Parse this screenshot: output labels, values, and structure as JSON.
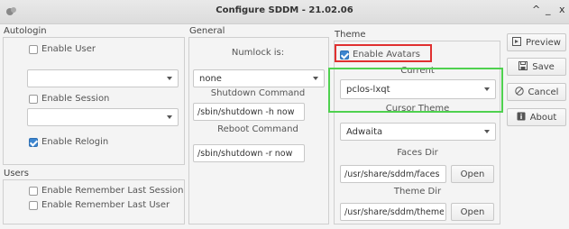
{
  "window": {
    "title": "Configure SDDM - 21.02.06",
    "controls": [
      "^",
      "_",
      "x"
    ]
  },
  "autologin": {
    "group_label": "Autologin",
    "enable_user": {
      "label": "Enable User",
      "checked": false
    },
    "user_combo": {
      "value": ""
    },
    "enable_session": {
      "label": "Enable Session",
      "checked": false
    },
    "session_combo": {
      "value": ""
    },
    "enable_relogin": {
      "label": "Enable Relogin",
      "checked": true
    }
  },
  "users": {
    "group_label": "Users",
    "remember_last_session": {
      "label": "Enable Remember Last Session",
      "checked": false
    },
    "remember_last_user": {
      "label": "Enable Remember Last User",
      "checked": false
    }
  },
  "general": {
    "group_label": "General",
    "numlock_label": "Numlock is:",
    "numlock_value": "none",
    "shutdown_label": "Shutdown Command",
    "shutdown_value": "/sbin/shutdown -h now",
    "reboot_label": "Reboot Command",
    "reboot_value": "/sbin/shutdown -r now"
  },
  "theme": {
    "group_label": "Theme",
    "enable_avatars": {
      "label": "Enable Avatars",
      "checked": true
    },
    "current_label": "Current",
    "current_value": "pclos-lxqt",
    "cursor_label": "Cursor Theme",
    "cursor_value": "Adwaita",
    "faces_label": "Faces Dir",
    "faces_value": "/usr/share/sddm/faces",
    "faces_open": "Open",
    "themedir_label": "Theme Dir",
    "themedir_value": "/usr/share/sddm/themes",
    "themedir_open": "Open"
  },
  "actions": {
    "preview": "Preview",
    "save": "Save",
    "cancel": "Cancel",
    "about": "About"
  },
  "highlights": {
    "red": "#e03030",
    "green": "#4fd14f",
    "accent": "#3d86d0"
  }
}
